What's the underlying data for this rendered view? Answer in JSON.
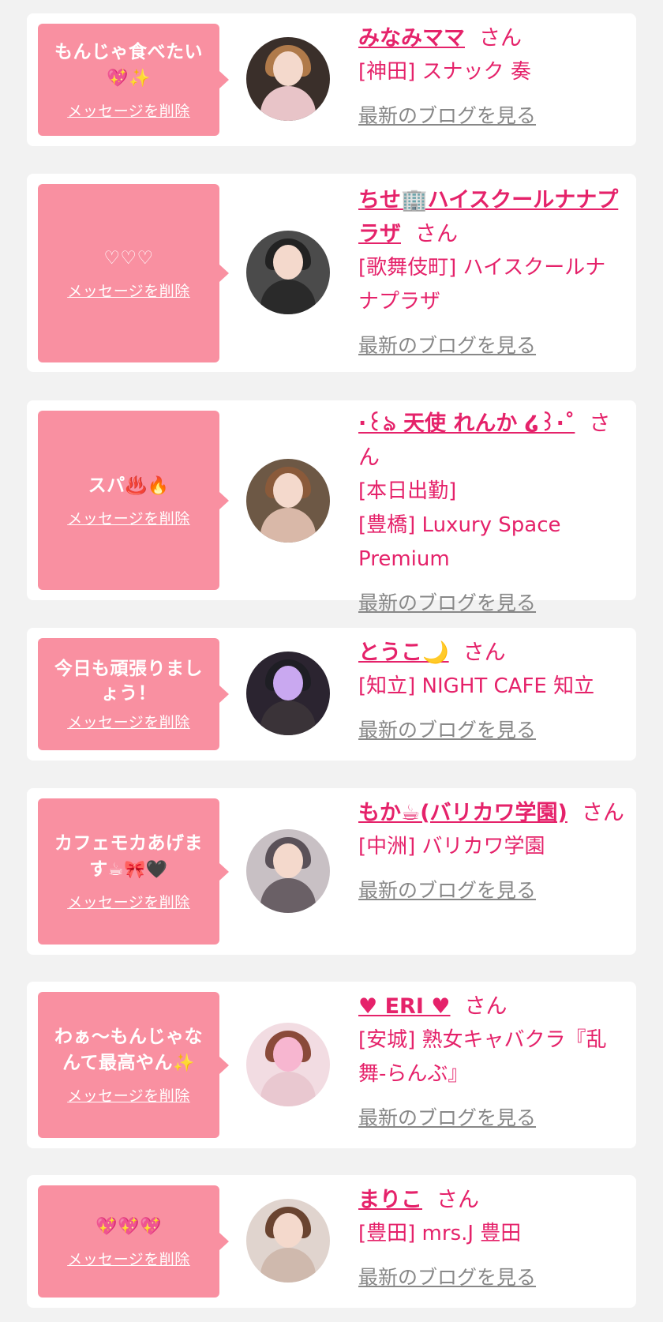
{
  "cards": [
    {
      "message": "もんじゃ食べたい",
      "message_icons": "💖✨",
      "delete_label": "メッセージを削除",
      "name": "みなみママ",
      "honorific": "さん",
      "shop_lines": [
        "[神田] スナック 奏"
      ],
      "blog_label": "最新のブログを見る"
    },
    {
      "message": "♡♡♡",
      "message_icons": "",
      "delete_label": "メッセージを削除",
      "name": "ちせ🏢ハイスクールナナプラザ",
      "honorific": "さん",
      "shop_lines": [
        "[歌舞伎町] ハイスクールナナプラザ"
      ],
      "blog_label": "最新のブログを見る"
    },
    {
      "message": "スパ",
      "message_icons": "♨️🔥",
      "delete_label": "メッセージを削除",
      "name": "·꒰ঌ 天使 れんか ໒꒱·˚",
      "honorific": "さん",
      "shop_lines": [
        "[本日出勤]",
        "[豊橋] Luxury Space Premium"
      ],
      "blog_label": "最新のブログを見る"
    },
    {
      "message": "今日も頑張りましょう！",
      "message_icons": "",
      "delete_label": "メッセージを削除",
      "name": "とうこ🌙",
      "honorific": "さん",
      "shop_lines": [
        "[知立] NIGHT CAFE 知立"
      ],
      "blog_label": "最新のブログを見る"
    },
    {
      "message": "カフェモカあげます",
      "message_icons": "☕🎀🖤",
      "delete_label": "メッセージを削除",
      "name": "もか☕(バリカワ学園)",
      "honorific": "さん",
      "shop_lines": [
        "[中洲] バリカワ学園"
      ],
      "blog_label": "最新のブログを見る"
    },
    {
      "message": "わぁ〜もんじゃなんて最高やん",
      "message_icons": "✨",
      "delete_label": "メッセージを削除",
      "name": "♥ ERI ♥",
      "honorific": "さん",
      "shop_lines": [
        "[安城] 熟女キャバクラ『乱舞-らんぶ』"
      ],
      "blog_label": "最新のブログを見る"
    },
    {
      "message": "",
      "message_icons": "💖💖💖",
      "delete_label": "メッセージを削除",
      "name": "まりこ",
      "honorific": "さん",
      "shop_lines": [
        "[豊田] mrs.J 豊田"
      ],
      "blog_label": "最新のブログを見る"
    }
  ],
  "colors": {
    "bubble": "#f990a1",
    "accent": "#e5226a",
    "link_gray": "#888888",
    "background": "#f2f2f2"
  }
}
